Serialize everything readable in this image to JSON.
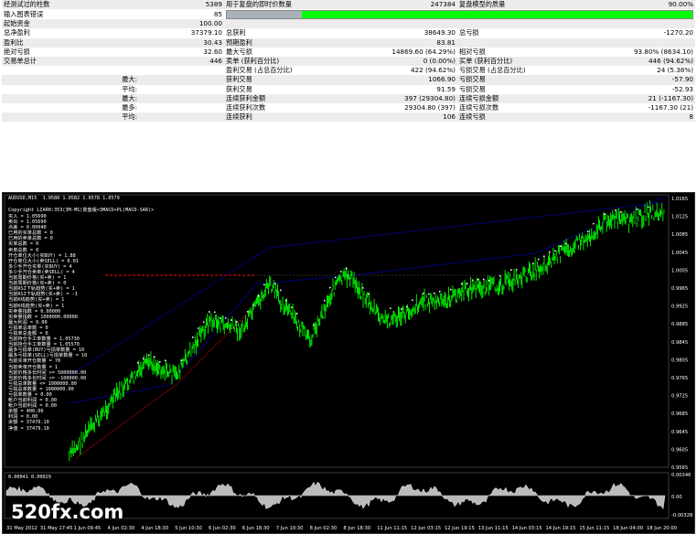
{
  "report": {
    "rows": [
      {
        "l1": "经测试过的柱数",
        "v1": "5389",
        "l2": "用于复盘的即时价数量",
        "v2": "247384",
        "l3": "复盘模型的质量",
        "v3": "90.00%"
      },
      {
        "l1": "输入图表错误",
        "v1": "85",
        "bar_quality": 0.9
      },
      {
        "l1": "起始资金",
        "v1": "100.00"
      },
      {
        "l1": "总净盈利",
        "v1": "37379.10",
        "l2": "总获利",
        "v2": "38649.30",
        "l3": "总亏损",
        "v3": "-1270.20"
      },
      {
        "l1": "盈利比",
        "v1": "30.43",
        "l2": "预期盈利",
        "v2": "83.81"
      },
      {
        "l1": "绝对亏损",
        "v1": "32.60",
        "l2": "最大亏损",
        "v2": "14869.60 (64.29%)",
        "l3": "相对亏损",
        "v3": "93.80% (8634.10)"
      },
      {
        "l1": "交易单总计",
        "v1": "446",
        "l2": "卖单 (获利百分比)",
        "v2": "0 (0.00%)",
        "l3": "买单 (获利百分比)",
        "v3": "446 (94.62%)"
      },
      {
        "l2": "盈利交易 (占总百分比)",
        "v2": "422 (94.62%)",
        "l3": "亏损交易 (占总百分比)",
        "v3": "24 (5.38%)"
      },
      {
        "l1b": "最大:",
        "l2": "获利交易",
        "v2": "1066.90",
        "l3": "亏损交易",
        "v3": "-57.90"
      },
      {
        "l1b": "平均:",
        "l2": "获利交易",
        "v2": "91.59",
        "l3": "亏损交易",
        "v3": "-52.93"
      },
      {
        "l1b": "最大:",
        "l2": "连续获利金额",
        "v2": "397 (29304.80)",
        "l3": "连续亏损金额",
        "v3": "21 (-1167.30)"
      },
      {
        "l1b": "最多:",
        "l2": "连续获利次数",
        "v2": "29304.80 (397)",
        "l3": "连续亏损次数",
        "v3": "-1167.30 (21)"
      },
      {
        "l1b": "平均:",
        "l2": "连续获利",
        "v2": "106",
        "l3": "连续亏损",
        "v3": "8"
      }
    ]
  },
  "chart": {
    "symbol_line": "AUDUSD,M15  1.0580 1.0582 1.0578 1.0579",
    "ea_title": "Copyright LIARH:353(3M-MS)复盘版<3MACD+PL(MACD-SAR)>",
    "info_lines": [
      "买入 = 1.05690",
      "卖出 = 1.05690",
      "点差 = 0.00040",
      "已用的买单总数 = 0",
      "已用的卖单总数 = 0",
      "买单总数 = 0",
      "卖单总数 = 0",
      "开仓单位大小(买BUY) = 1.88",
      "开仓单位大小(卖SELL) = 0.01",
      "多少手开仓买单(买BUY) = 4",
      "多少手开仓卖单(卖SELL) = 4",
      "当前周期价格(买+卖) = 1",
      "当前周期价格(买+卖) = 0",
      "当前RSI下轨趋势(买+卖) = 1",
      "当前RSI下轨趋势(买+卖) = -1",
      "当前K线趋势(买+卖) = 1",
      "当前K线趋势(买+卖) = 1",
      "买卖量指数 = 0.00000",
      "买卖量指数 = 1000000.00000",
      "最大利润 = 0.00",
      "亏损单总单数 = 0",
      "亏损单总金额 = 0",
      "当前持仓手工单数量 = 1.05730",
      "当前持仓手工单数量 = 1.05570",
      "最多亏损单(BUY)亏损单数量 = 10",
      "最多亏损单(SELL)亏损单数量 = 10",
      "当前买单开仓数量 = 70",
      "当前卖单开仓数量 = 1",
      "当前价格多长时间 >= 5000000.00",
      "当前价格多长时间 <= -100000.00",
      "亏损总单数量 <= 1000000.00",
      "亏损总单数量 = 1000000.00",
      "亏损单数量 = 0.00",
      "帐户当前利润 = 0.00",
      "帐户当前利润 = 0.00",
      "余额 = 400.00",
      "利润 = 0.00",
      "余额 = 37479.10",
      "净值 = 37479.10"
    ],
    "price_labels": [
      "1.0165",
      "1.0125",
      "1.0085",
      "1.0045",
      "1.0005",
      "0.9965",
      "0.9925",
      "0.9885",
      "0.9845",
      "0.9805",
      "0.9765",
      "0.9725",
      "0.9685",
      "0.9645",
      "0.9605",
      "0.9565"
    ],
    "indicator_line": "0.00041 0.00029",
    "indicator_labels": [
      "0.00346",
      "0.00",
      "-0.00328"
    ],
    "time_labels": [
      "31 May 2012",
      "31 May 17:45",
      "1 Jun 09:45",
      "4 Jun 02:30",
      "4 Jun 18:30",
      "5 Jun 10:30",
      "6 Jun 02:30",
      "6 Jun 18:30",
      "7 Jun 10:30",
      "8 Jun 02:30",
      "8 Jun 18:30",
      "11 Jun 11:15",
      "12 Jun 03:15",
      "12 Jun 19:15",
      "13 Jun 11:15",
      "14 Jun 03:15",
      "14 Jun 19:15",
      "15 Jun 11:15",
      "18 Jun 04:00",
      "18 Jun 20:00"
    ],
    "colors": {
      "candle": "#00ff00",
      "equity": "#0000cc",
      "sell": "#cc0000",
      "grid": "#333333",
      "bg": "#000000"
    }
  },
  "watermark": "520fx.com"
}
